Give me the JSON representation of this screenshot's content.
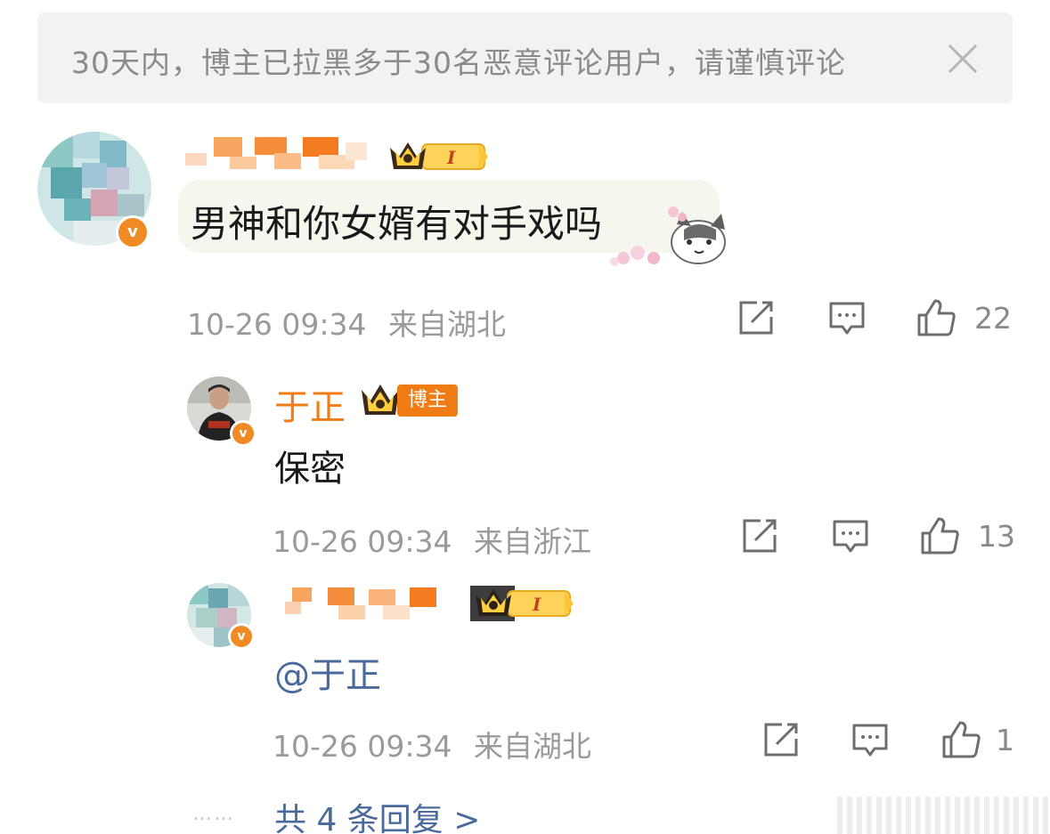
{
  "notice": {
    "text": "30天内，博主已拉黑多于30名恶意评论用户，请谨慎评论",
    "close_icon": "close-icon"
  },
  "comment": {
    "text": "男神和你女婿有对手戏吗",
    "time": "10-26 09:34",
    "location": "来自湖北",
    "like_count": "22",
    "avatar_badge": "v"
  },
  "replies": [
    {
      "username": "于正",
      "role_badge": "博主",
      "text": "保密",
      "time": "10-26 09:34",
      "location": "来自浙江",
      "like_count": "13",
      "avatar_badge": "v"
    },
    {
      "text_prefix": "@",
      "mention": "于正",
      "time": "10-26 09:34",
      "location": "来自湖北",
      "like_count": "1",
      "avatar_badge": "v"
    }
  ],
  "footer": {
    "dots": "……",
    "more_replies": "共 4 条回复 >"
  },
  "colors": {
    "accent_orange": "#f07c16",
    "link_blue": "#4a6a9c",
    "meta_gray": "#9a9a9a",
    "notice_bg": "#f2f2f2"
  }
}
